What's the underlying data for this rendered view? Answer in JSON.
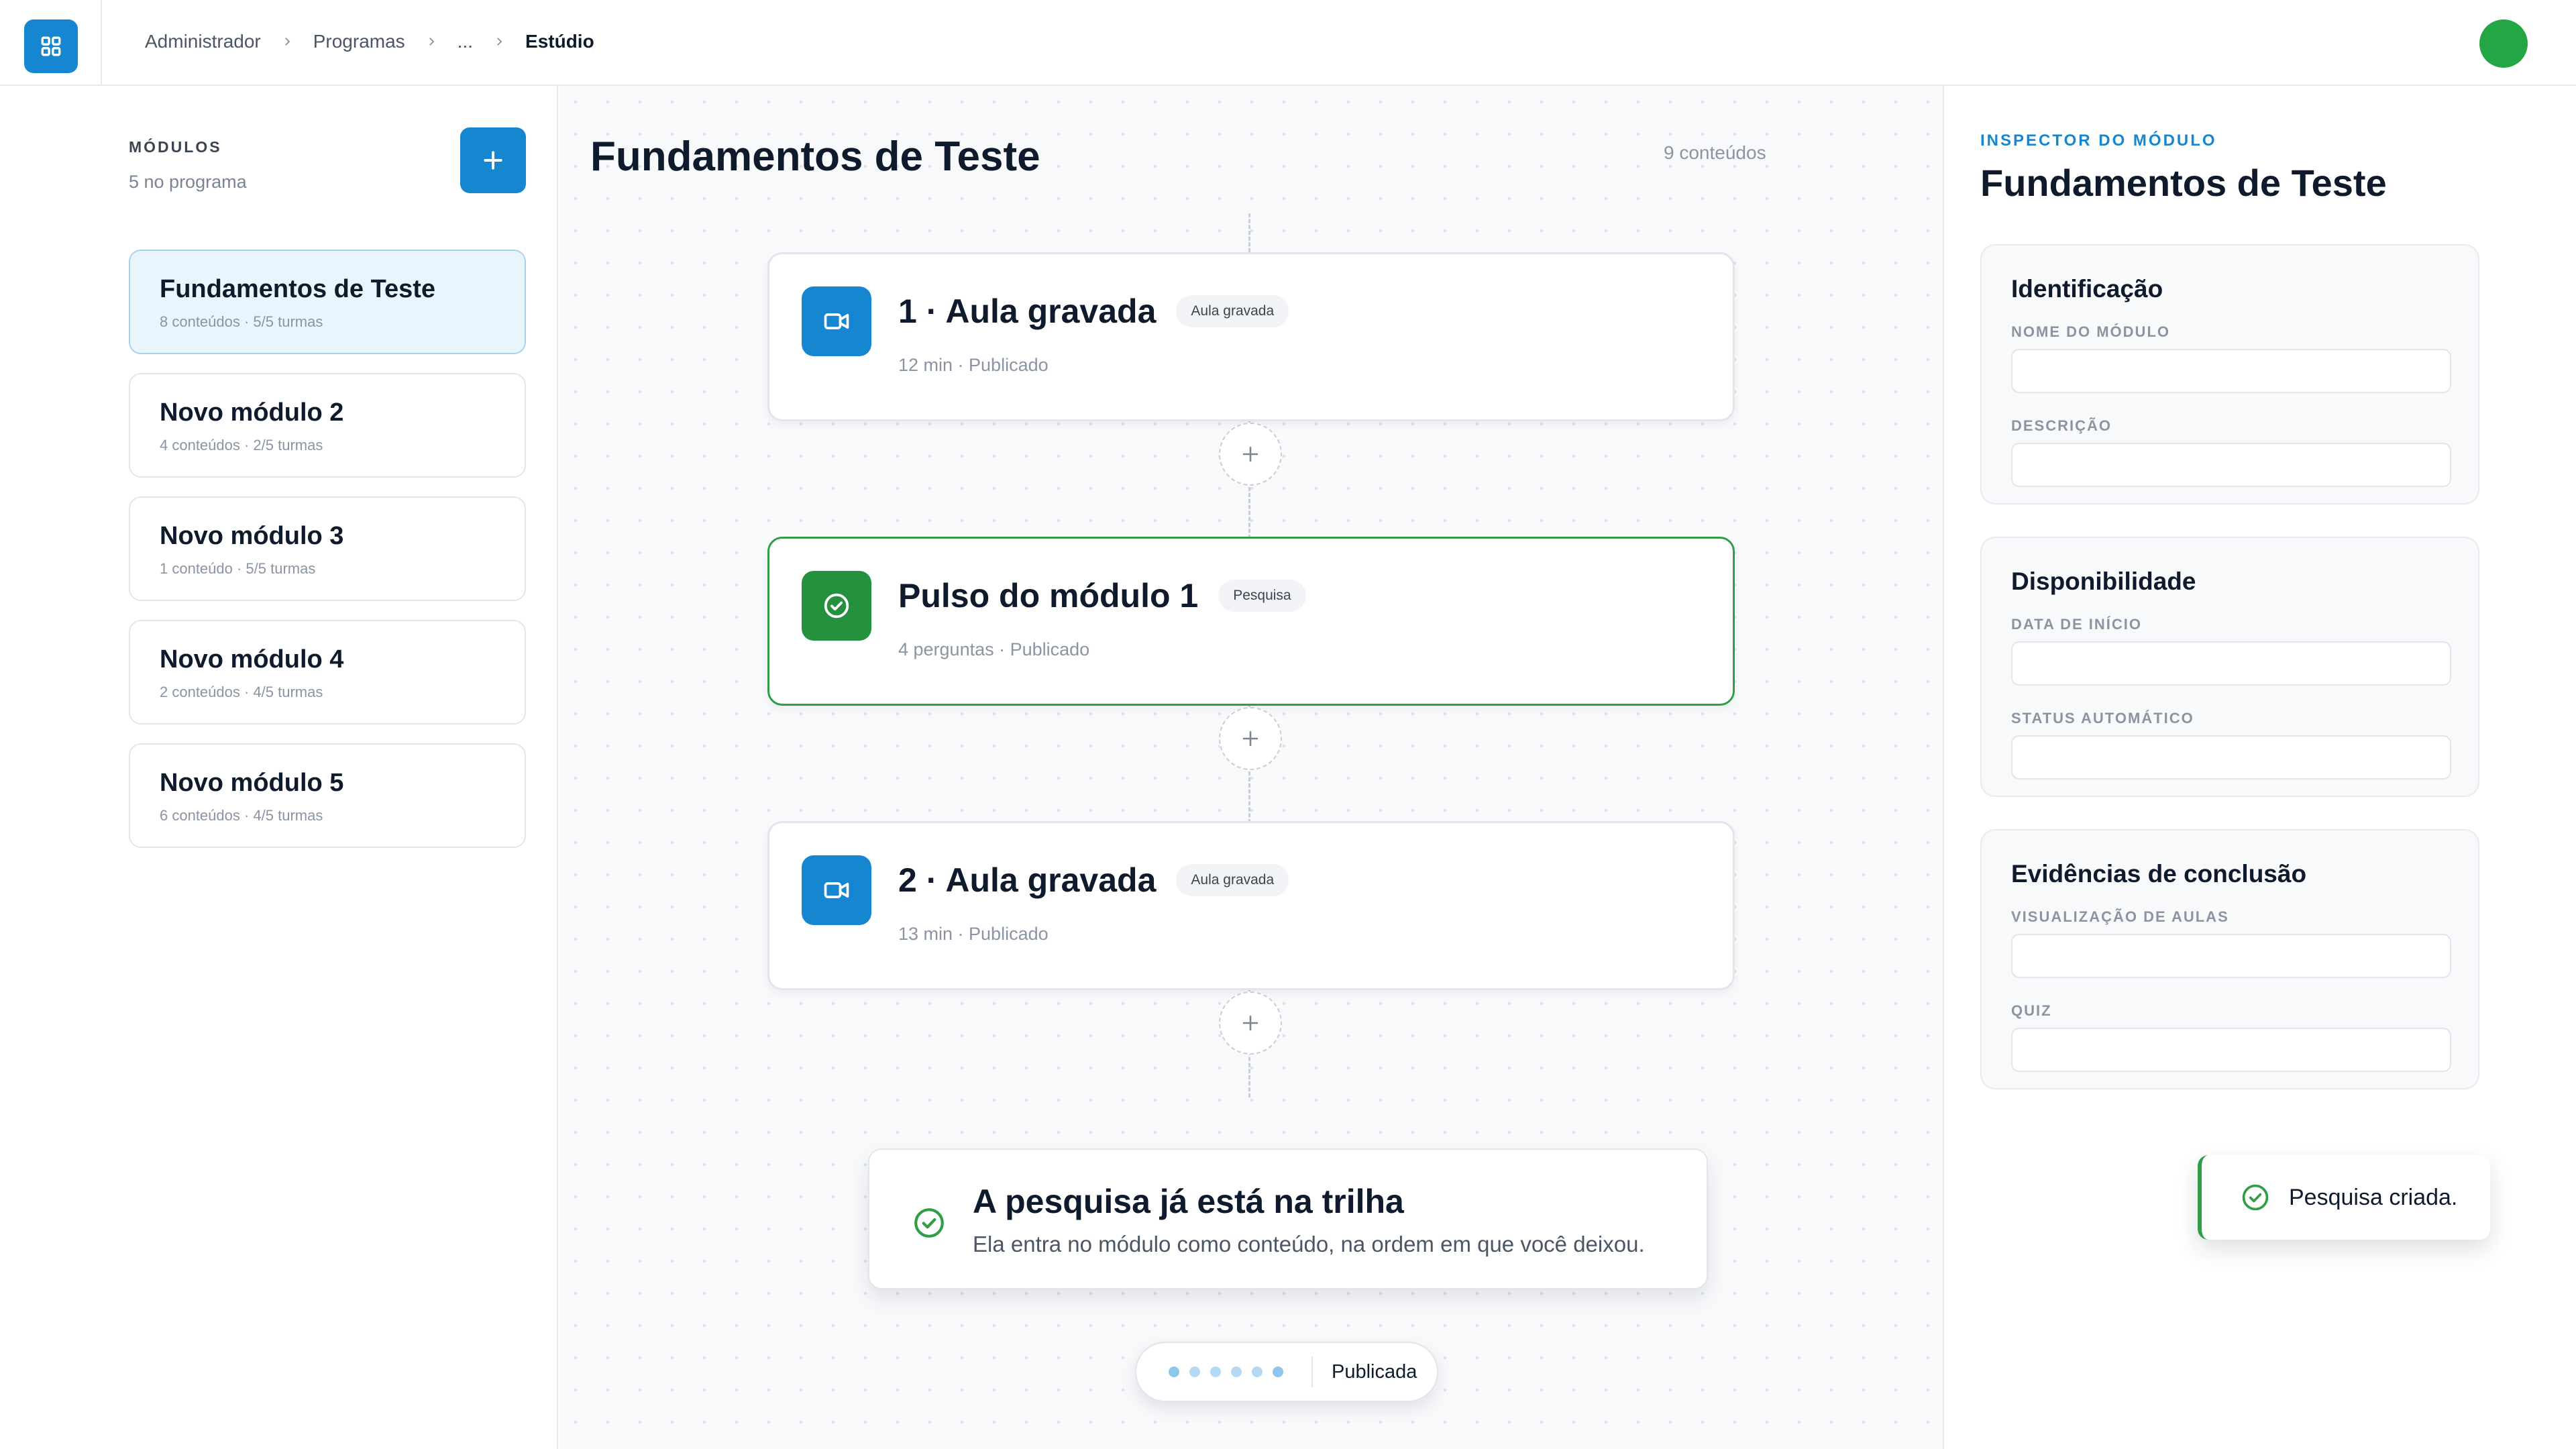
{
  "breadcrumb": {
    "items": [
      "Administrador",
      "Programas",
      "..."
    ],
    "current": "Estúdio"
  },
  "sidebar": {
    "title": "MÓDULOS",
    "subtitle": "5 no programa",
    "modules": [
      {
        "name": "Fundamentos de Teste",
        "meta": "8 conteúdos · 5/5 turmas",
        "active": true
      },
      {
        "name": "Novo módulo 2",
        "meta": "4 conteúdos · 2/5 turmas"
      },
      {
        "name": "Novo módulo 3",
        "meta": "1 conteúdo · 5/5 turmas"
      },
      {
        "name": "Novo módulo 4",
        "meta": "2 conteúdos · 4/5 turmas"
      },
      {
        "name": "Novo módulo 5",
        "meta": "6 conteúdos · 4/5 turmas"
      }
    ]
  },
  "canvas": {
    "title": "Fundamentos de Teste",
    "count": "9 conteúdos",
    "cards": [
      {
        "title": "1 · Aula gravada",
        "tag": "Aula gravada",
        "meta": "12 min · Publicado",
        "icon": "video-icon"
      },
      {
        "title": "Pulso do módulo 1",
        "tag": "Pesquisa",
        "meta": "4 perguntas · Publicado",
        "icon": "check-circle-icon",
        "selected": true
      },
      {
        "title": "2 · Aula gravada",
        "tag": "Aula gravada",
        "meta": "13 min · Publicado",
        "icon": "video-icon"
      }
    ],
    "notice": {
      "title": "A pesquisa já está na trilha",
      "text": "Ela entra no módulo como conteúdo, na ordem em que você deixou."
    },
    "status": {
      "label": "Publicada"
    }
  },
  "inspector": {
    "label": "INSPECTOR DO MÓDULO",
    "title": "Fundamentos de Teste",
    "sections": [
      {
        "title": "Identificação",
        "fields": [
          "NOME DO MÓDULO",
          "DESCRIÇÃO"
        ]
      },
      {
        "title": "Disponibilidade",
        "fields": [
          "DATA DE INÍCIO",
          "STATUS AUTOMÁTICO"
        ]
      },
      {
        "title": "Evidências de conclusão",
        "fields": [
          "VISUALIZAÇÃO DE AULAS",
          "QUIZ"
        ]
      }
    ]
  },
  "toast": {
    "text": "Pesquisa criada."
  },
  "colors": {
    "accent": "#1686d0",
    "success": "#2f9e47",
    "avatar": "#23a745"
  }
}
